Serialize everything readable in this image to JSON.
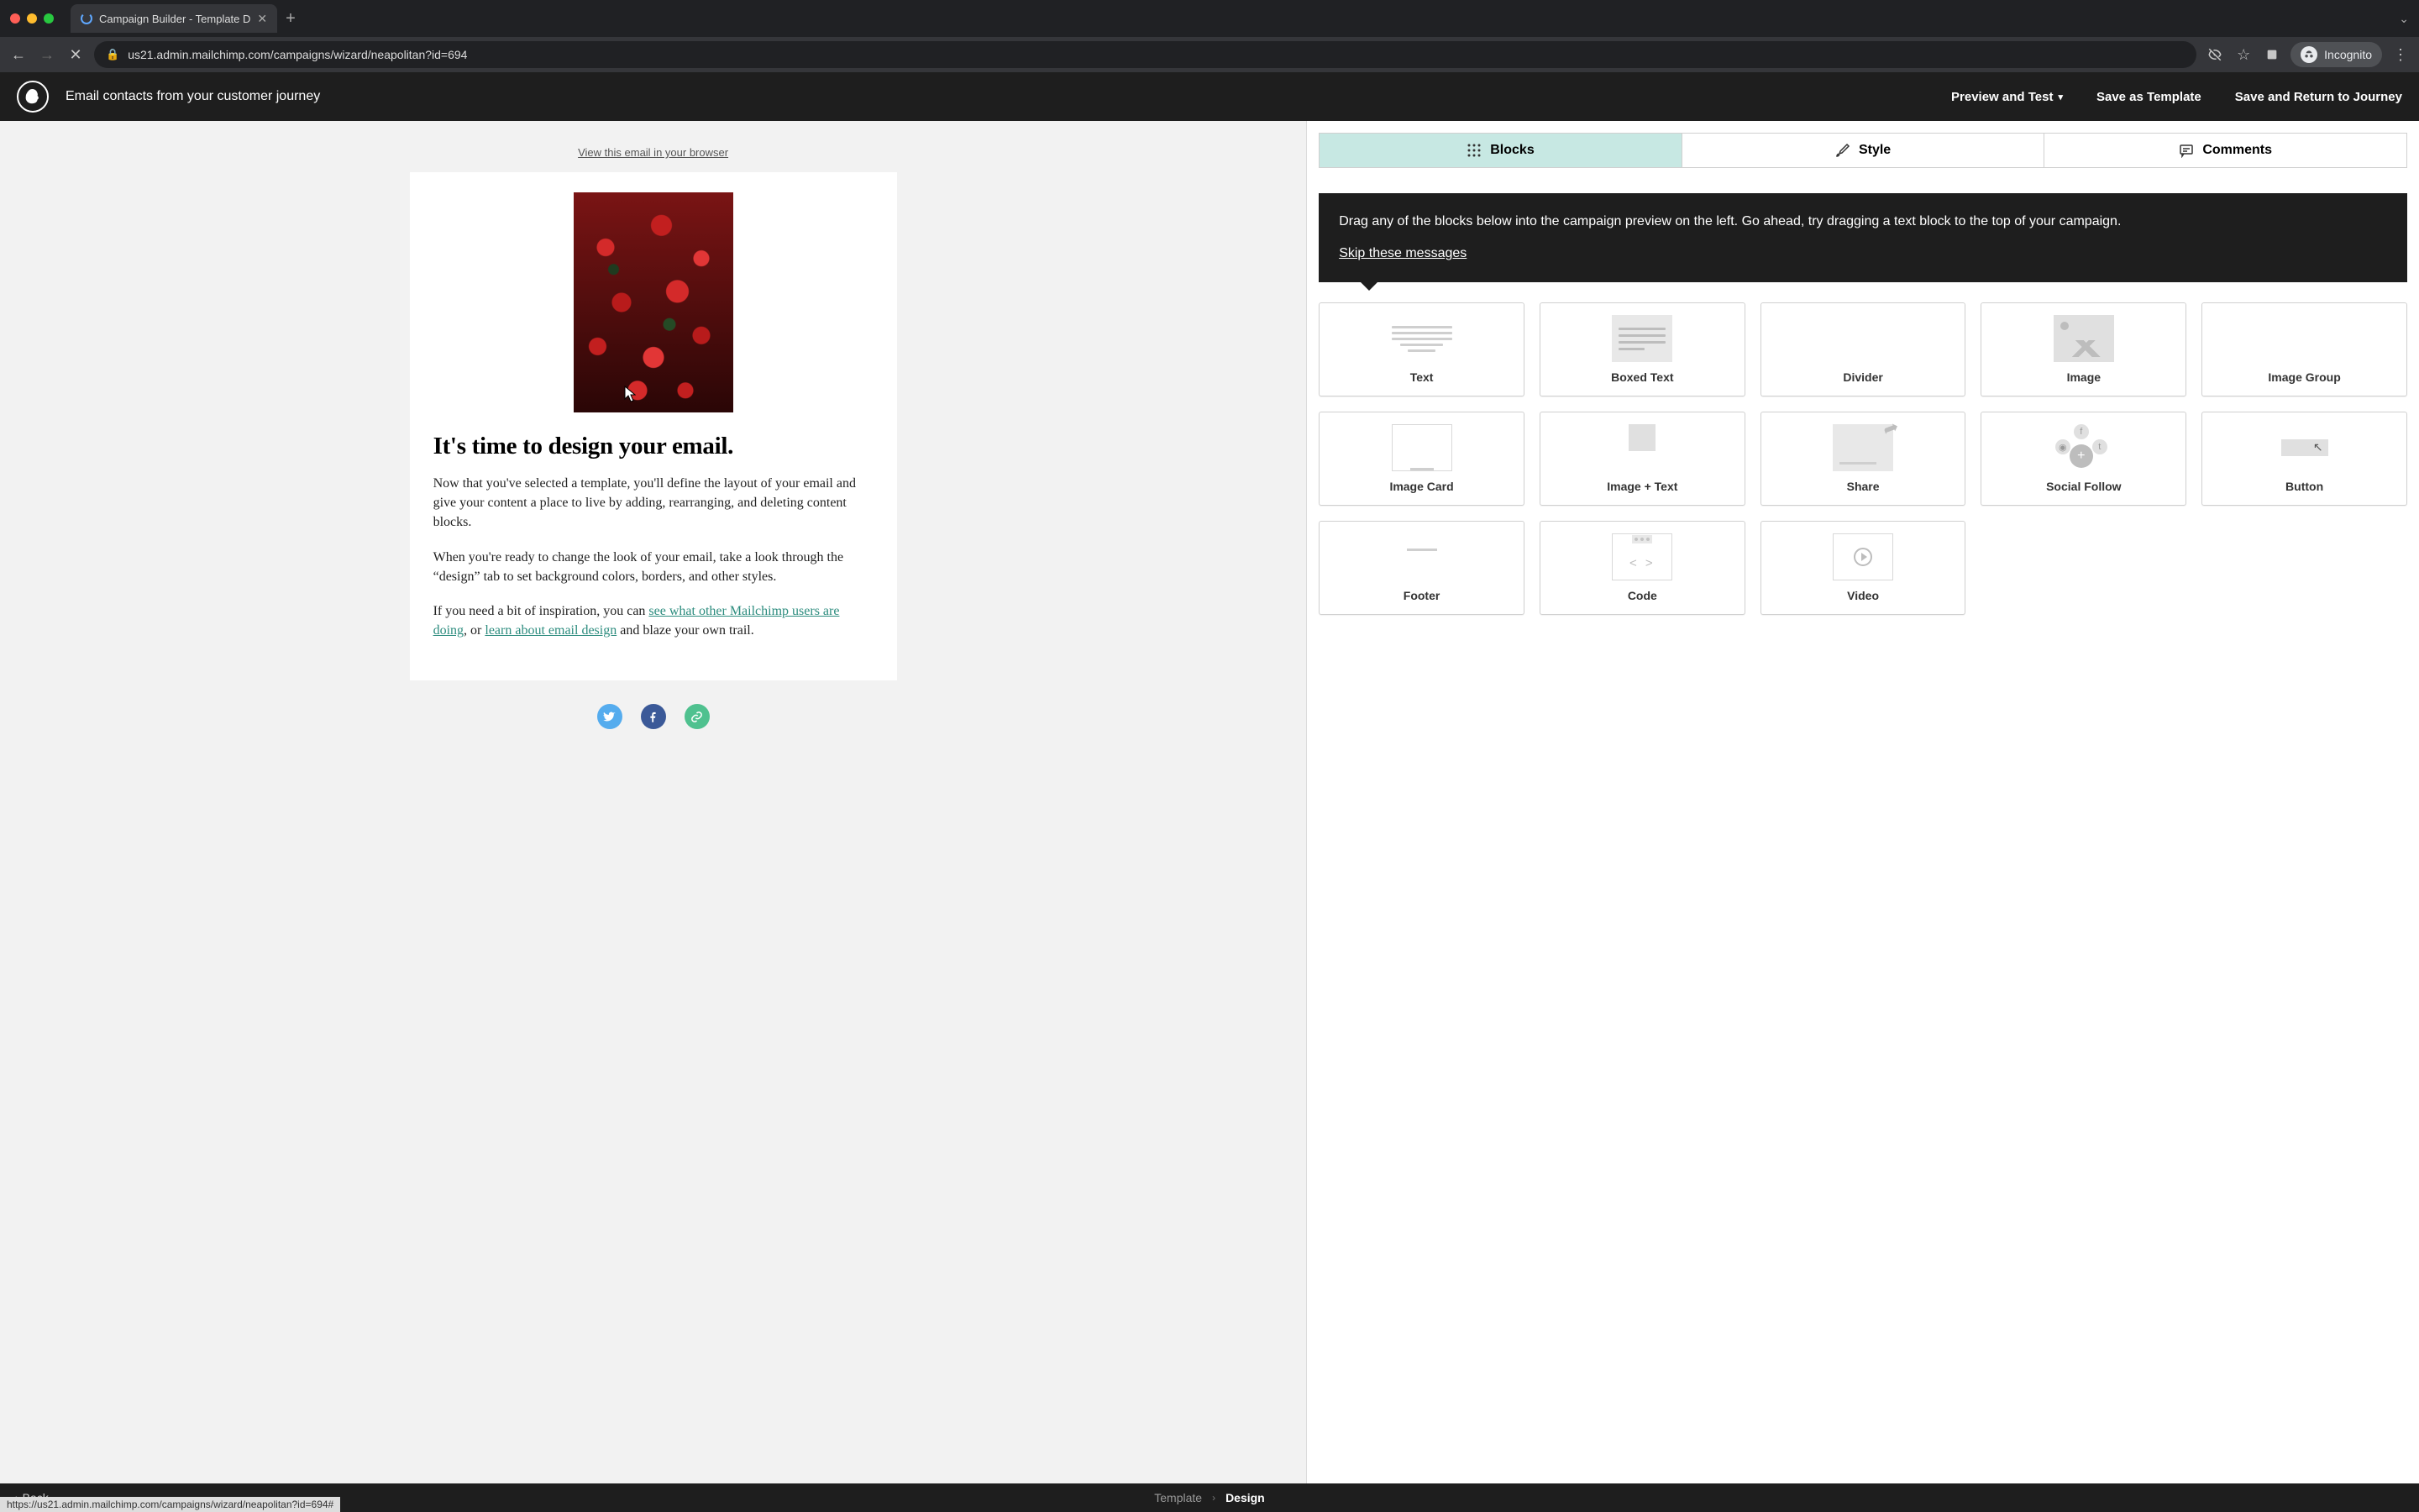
{
  "browser": {
    "tab_title": "Campaign Builder - Template D",
    "url": "us21.admin.mailchimp.com/campaigns/wizard/neapolitan?id=694",
    "incognito_label": "Incognito",
    "status_url": "https://us21.admin.mailchimp.com/campaigns/wizard/neapolitan?id=694#"
  },
  "topbar": {
    "title": "Email contacts from your customer journey",
    "preview_label": "Preview and Test",
    "save_template_label": "Save as Template",
    "save_return_label": "Save and Return to Journey"
  },
  "preview": {
    "view_browser": "View this email in your browser",
    "heading": "It's time to design your email.",
    "p1": "Now that you've selected a template, you'll define the layout of your email and give your content a place to live by adding, rearranging, and deleting content blocks.",
    "p2": "When you're ready to change the look of your email, take a look through the “design” tab to set background colors, borders, and other styles.",
    "p3_prefix": "If you need a bit of inspiration, you can ",
    "p3_link1": "see what other Mailchimp users are doing",
    "p3_mid": ", or ",
    "p3_link2": "learn about email design",
    "p3_suffix": " and blaze your own trail."
  },
  "builder": {
    "tabs": {
      "blocks": "Blocks",
      "style": "Style",
      "comments": "Comments"
    },
    "tip_text": "Drag any of the blocks below into the campaign preview on the left. Go ahead, try dragging a text block to the top of your campaign.",
    "tip_skip": "Skip these messages",
    "blocks": {
      "text": "Text",
      "boxed_text": "Boxed Text",
      "divider": "Divider",
      "image": "Image",
      "image_group": "Image Group",
      "image_card": "Image Card",
      "image_text": "Image + Text",
      "share": "Share",
      "social_follow": "Social Follow",
      "button": "Button",
      "footer": "Footer",
      "code": "Code",
      "video": "Video"
    }
  },
  "bottom": {
    "back": "Back",
    "crumb_template": "Template",
    "crumb_design": "Design"
  }
}
